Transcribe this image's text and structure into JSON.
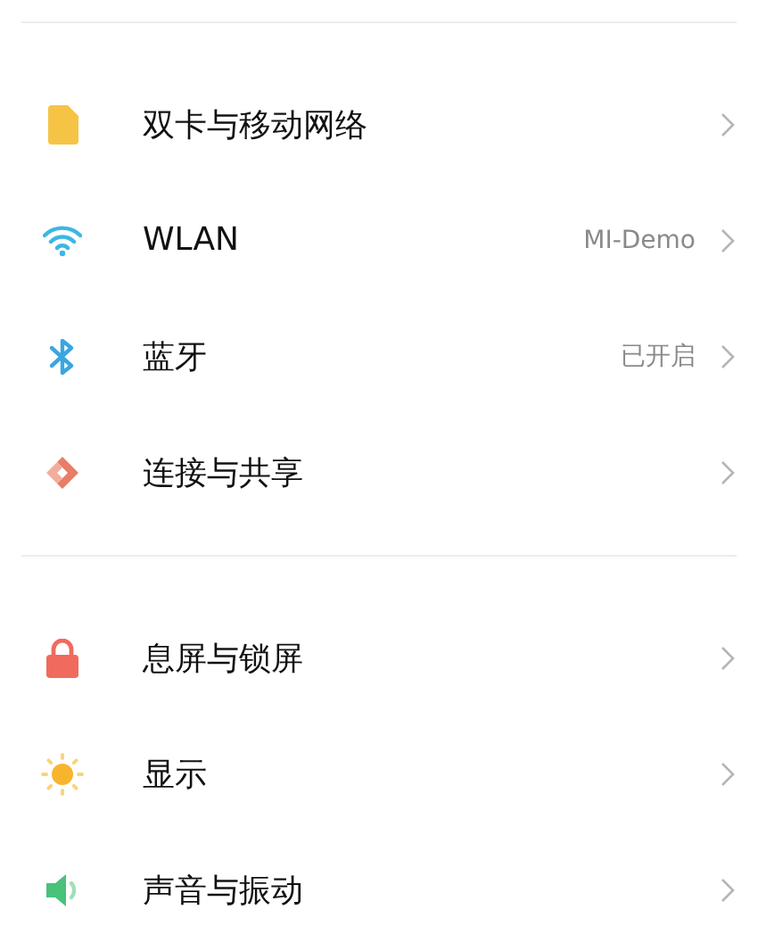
{
  "sections": [
    {
      "items": [
        {
          "label": "双卡与移动网络"
        },
        {
          "label": "WLAN",
          "value": "MI-Demo"
        },
        {
          "label": "蓝牙",
          "value": "已开启"
        },
        {
          "label": "连接与共享"
        }
      ]
    },
    {
      "items": [
        {
          "label": "息屏与锁屏"
        },
        {
          "label": "显示"
        },
        {
          "label": "声音与振动"
        }
      ]
    }
  ]
}
